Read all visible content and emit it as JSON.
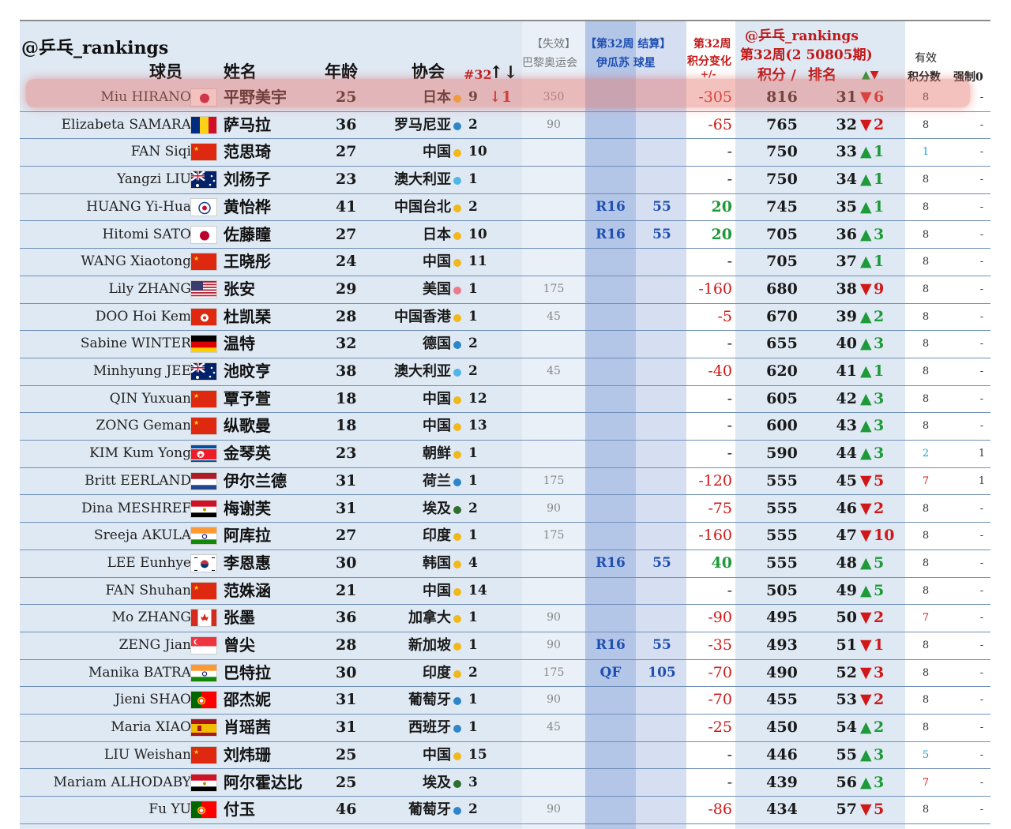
{
  "header": {
    "handle": "@乒乓_rankings",
    "col_player": "球员",
    "col_name": "姓名",
    "col_age": "年龄",
    "col_assoc": "协会",
    "col_rank_marker": "#32",
    "col_rank_arrows": "↑↓",
    "expired_label": "【失效】",
    "paris_label": "巴黎奥运会",
    "tournament_label": "【第32周 结算】",
    "tournament_name": "伊瓜苏 球星",
    "change_label_1": "第32周",
    "change_label_2": "积分变化",
    "change_label_3": "+/-",
    "handle_right": "@乒乓_rankings",
    "week_label": "第32周(2 50805期)",
    "points_label": "积分 /",
    "rank_label": "排名",
    "move_label": "▲▼",
    "valid_label_1": "有效",
    "valid_label_2": "积分数",
    "forced_label": "强制0"
  },
  "colors": {
    "up_green": "#1f9a3a",
    "down_red": "#d01818",
    "blue_band": "#b9cbe9",
    "dot_yellow": "#f1b81c",
    "dot_blue": "#2e86c8",
    "dot_lightblue": "#4fb6e8",
    "dot_pink": "#ea7b8a",
    "dot_green": "#2f6e2f"
  },
  "players": [
    {
      "en": "Miu HIRANO",
      "cn": "平野美宇",
      "flag": "JP",
      "age": "25",
      "assoc": "日本",
      "dot": "yellow",
      "count": "9",
      "count_arrow": "↓1",
      "paris": "350",
      "round": "",
      "round_pts": "",
      "change": "-305",
      "points": "816",
      "rank": "31",
      "dir": "down",
      "move": "6",
      "valid": "8",
      "forced": "-"
    },
    {
      "en": "Elizabeta SAMARA",
      "cn": "萨马拉",
      "flag": "RO",
      "age": "36",
      "assoc": "罗马尼亚",
      "dot": "blue",
      "count": "2",
      "count_arrow": "",
      "paris": "90",
      "round": "",
      "round_pts": "",
      "change": "-65",
      "points": "765",
      "rank": "32",
      "dir": "down",
      "move": "2",
      "valid": "8",
      "forced": "-"
    },
    {
      "en": "FAN Siqi",
      "cn": "范思琦",
      "flag": "CN",
      "age": "27",
      "assoc": "中国",
      "dot": "yellow",
      "count": "10",
      "count_arrow": "",
      "paris": "",
      "round": "",
      "round_pts": "",
      "change": "-",
      "points": "750",
      "rank": "33",
      "dir": "up",
      "move": "1",
      "valid": "1",
      "forced": "-"
    },
    {
      "en": "Yangzi LIU",
      "cn": "刘杨子",
      "flag": "AU",
      "age": "23",
      "assoc": "澳大利亚",
      "dot": "lightblue",
      "count": "1",
      "count_arrow": "",
      "paris": "",
      "round": "",
      "round_pts": "",
      "change": "-",
      "points": "750",
      "rank": "34",
      "dir": "up",
      "move": "1",
      "valid": "8",
      "forced": "-"
    },
    {
      "en": "HUANG Yi-Hua",
      "cn": "黄怡桦",
      "flag": "TPE",
      "age": "41",
      "assoc": "中国台北",
      "dot": "yellow",
      "count": "2",
      "count_arrow": "",
      "paris": "",
      "round": "R16",
      "round_pts": "55",
      "change": "20",
      "points": "745",
      "rank": "35",
      "dir": "up",
      "move": "1",
      "valid": "8",
      "forced": "-"
    },
    {
      "en": "Hitomi SATO",
      "cn": "佐藤瞳",
      "flag": "JP",
      "age": "27",
      "assoc": "日本",
      "dot": "yellow",
      "count": "10",
      "count_arrow": "",
      "paris": "",
      "round": "R16",
      "round_pts": "55",
      "change": "20",
      "points": "705",
      "rank": "36",
      "dir": "up",
      "move": "3",
      "valid": "8",
      "forced": "-"
    },
    {
      "en": "WANG Xiaotong",
      "cn": "王晓彤",
      "flag": "CN",
      "age": "24",
      "assoc": "中国",
      "dot": "yellow",
      "count": "11",
      "count_arrow": "",
      "paris": "",
      "round": "",
      "round_pts": "",
      "change": "-",
      "points": "705",
      "rank": "37",
      "dir": "up",
      "move": "1",
      "valid": "8",
      "forced": "-"
    },
    {
      "en": "Lily ZHANG",
      "cn": "张安",
      "flag": "US",
      "age": "29",
      "assoc": "美国",
      "dot": "pink",
      "count": "1",
      "count_arrow": "",
      "paris": "175",
      "round": "",
      "round_pts": "",
      "change": "-160",
      "points": "680",
      "rank": "38",
      "dir": "down",
      "move": "9",
      "valid": "8",
      "forced": "-"
    },
    {
      "en": "DOO Hoi Kem",
      "cn": "杜凯琹",
      "flag": "HK",
      "age": "28",
      "assoc": "中国香港",
      "dot": "yellow",
      "count": "1",
      "count_arrow": "",
      "paris": "45",
      "round": "",
      "round_pts": "",
      "change": "-5",
      "points": "670",
      "rank": "39",
      "dir": "up",
      "move": "2",
      "valid": "8",
      "forced": "-"
    },
    {
      "en": "Sabine WINTER",
      "cn": "温特",
      "flag": "DE",
      "age": "32",
      "assoc": "德国",
      "dot": "blue",
      "count": "2",
      "count_arrow": "",
      "paris": "",
      "round": "",
      "round_pts": "",
      "change": "-",
      "points": "655",
      "rank": "40",
      "dir": "up",
      "move": "3",
      "valid": "8",
      "forced": "-"
    },
    {
      "en": "Minhyung JEE",
      "cn": "池旼亨",
      "flag": "AU",
      "age": "38",
      "assoc": "澳大利亚",
      "dot": "lightblue",
      "count": "2",
      "count_arrow": "",
      "paris": "45",
      "round": "",
      "round_pts": "",
      "change": "-40",
      "points": "620",
      "rank": "41",
      "dir": "up",
      "move": "1",
      "valid": "8",
      "forced": "-"
    },
    {
      "en": "QIN Yuxuan",
      "cn": "覃予萱",
      "flag": "CN",
      "age": "18",
      "assoc": "中国",
      "dot": "yellow",
      "count": "12",
      "count_arrow": "",
      "paris": "",
      "round": "",
      "round_pts": "",
      "change": "-",
      "points": "605",
      "rank": "42",
      "dir": "up",
      "move": "3",
      "valid": "8",
      "forced": "-"
    },
    {
      "en": "ZONG Geman",
      "cn": "纵歌曼",
      "flag": "CN",
      "age": "18",
      "assoc": "中国",
      "dot": "yellow",
      "count": "13",
      "count_arrow": "",
      "paris": "",
      "round": "",
      "round_pts": "",
      "change": "-",
      "points": "600",
      "rank": "43",
      "dir": "up",
      "move": "3",
      "valid": "8",
      "forced": "-"
    },
    {
      "en": "KIM Kum Yong",
      "cn": "金琴英",
      "flag": "KP",
      "age": "23",
      "assoc": "朝鲜",
      "dot": "yellow",
      "count": "1",
      "count_arrow": "",
      "paris": "",
      "round": "",
      "round_pts": "",
      "change": "-",
      "points": "590",
      "rank": "44",
      "dir": "up",
      "move": "3",
      "valid": "2",
      "forced": "1"
    },
    {
      "en": "Britt EERLAND",
      "cn": "伊尔兰德",
      "flag": "NL",
      "age": "31",
      "assoc": "荷兰",
      "dot": "blue",
      "count": "1",
      "count_arrow": "",
      "paris": "175",
      "round": "",
      "round_pts": "",
      "change": "-120",
      "points": "555",
      "rank": "45",
      "dir": "down",
      "move": "5",
      "valid": "7",
      "forced": "1"
    },
    {
      "en": "Dina MESHREF",
      "cn": "梅谢芙",
      "flag": "EG",
      "age": "31",
      "assoc": "埃及",
      "dot": "green",
      "count": "2",
      "count_arrow": "",
      "paris": "90",
      "round": "",
      "round_pts": "",
      "change": "-75",
      "points": "555",
      "rank": "46",
      "dir": "down",
      "move": "2",
      "valid": "8",
      "forced": "-"
    },
    {
      "en": "Sreeja AKULA",
      "cn": "阿库拉",
      "flag": "IN",
      "age": "27",
      "assoc": "印度",
      "dot": "yellow",
      "count": "1",
      "count_arrow": "",
      "paris": "175",
      "round": "",
      "round_pts": "",
      "change": "-160",
      "points": "555",
      "rank": "47",
      "dir": "down",
      "move": "10",
      "valid": "8",
      "forced": "-"
    },
    {
      "en": "LEE Eunhye",
      "cn": "李恩惠",
      "flag": "KR",
      "age": "30",
      "assoc": "韩国",
      "dot": "yellow",
      "count": "4",
      "count_arrow": "",
      "paris": "",
      "round": "R16",
      "round_pts": "55",
      "change": "40",
      "points": "555",
      "rank": "48",
      "dir": "up",
      "move": "5",
      "valid": "8",
      "forced": "-"
    },
    {
      "en": "FAN Shuhan",
      "cn": "范姝涵",
      "flag": "CN",
      "age": "21",
      "assoc": "中国",
      "dot": "yellow",
      "count": "14",
      "count_arrow": "",
      "paris": "",
      "round": "",
      "round_pts": "",
      "change": "-",
      "points": "505",
      "rank": "49",
      "dir": "up",
      "move": "5",
      "valid": "8",
      "forced": "-"
    },
    {
      "en": "Mo ZHANG",
      "cn": "张墨",
      "flag": "CA",
      "age": "36",
      "assoc": "加拿大",
      "dot": "yellow",
      "count": "1",
      "count_arrow": "",
      "paris": "90",
      "round": "",
      "round_pts": "",
      "change": "-90",
      "points": "495",
      "rank": "50",
      "dir": "down",
      "move": "2",
      "valid": "7",
      "forced": "-"
    },
    {
      "en": "ZENG Jian",
      "cn": "曾尖",
      "flag": "SG",
      "age": "28",
      "assoc": "新加坡",
      "dot": "yellow",
      "count": "1",
      "count_arrow": "",
      "paris": "90",
      "round": "R16",
      "round_pts": "55",
      "change": "-35",
      "points": "493",
      "rank": "51",
      "dir": "down",
      "move": "1",
      "valid": "8",
      "forced": "-"
    },
    {
      "en": "Manika BATRA",
      "cn": "巴特拉",
      "flag": "IN",
      "age": "30",
      "assoc": "印度",
      "dot": "yellow",
      "count": "2",
      "count_arrow": "",
      "paris": "175",
      "round": "QF",
      "round_pts": "105",
      "change": "-70",
      "points": "490",
      "rank": "52",
      "dir": "down",
      "move": "3",
      "valid": "8",
      "forced": "-"
    },
    {
      "en": "Jieni SHAO",
      "cn": "邵杰妮",
      "flag": "PT",
      "age": "31",
      "assoc": "葡萄牙",
      "dot": "blue",
      "count": "1",
      "count_arrow": "",
      "paris": "90",
      "round": "",
      "round_pts": "",
      "change": "-70",
      "points": "455",
      "rank": "53",
      "dir": "down",
      "move": "2",
      "valid": "8",
      "forced": "-"
    },
    {
      "en": "Maria XIAO",
      "cn": "肖瑶茜",
      "flag": "ES",
      "age": "31",
      "assoc": "西班牙",
      "dot": "blue",
      "count": "1",
      "count_arrow": "",
      "paris": "45",
      "round": "",
      "round_pts": "",
      "change": "-25",
      "points": "450",
      "rank": "54",
      "dir": "up",
      "move": "2",
      "valid": "8",
      "forced": "-"
    },
    {
      "en": "LIU Weishan",
      "cn": "刘炜珊",
      "flag": "CN",
      "age": "25",
      "assoc": "中国",
      "dot": "yellow",
      "count": "15",
      "count_arrow": "",
      "paris": "",
      "round": "",
      "round_pts": "",
      "change": "-",
      "points": "446",
      "rank": "55",
      "dir": "up",
      "move": "3",
      "valid": "5",
      "forced": "-"
    },
    {
      "en": "Mariam ALHODABY",
      "cn": "阿尔霍达比",
      "flag": "EG",
      "age": "25",
      "assoc": "埃及",
      "dot": "green",
      "count": "3",
      "count_arrow": "",
      "paris": "",
      "round": "",
      "round_pts": "",
      "change": "-",
      "points": "439",
      "rank": "56",
      "dir": "up",
      "move": "3",
      "valid": "7",
      "forced": "-"
    },
    {
      "en": "Fu YU",
      "cn": "付玉",
      "flag": "PT",
      "age": "46",
      "assoc": "葡萄牙",
      "dot": "blue",
      "count": "2",
      "count_arrow": "",
      "paris": "90",
      "round": "",
      "round_pts": "",
      "change": "-86",
      "points": "434",
      "rank": "57",
      "dir": "down",
      "move": "5",
      "valid": "8",
      "forced": "-"
    }
  ]
}
